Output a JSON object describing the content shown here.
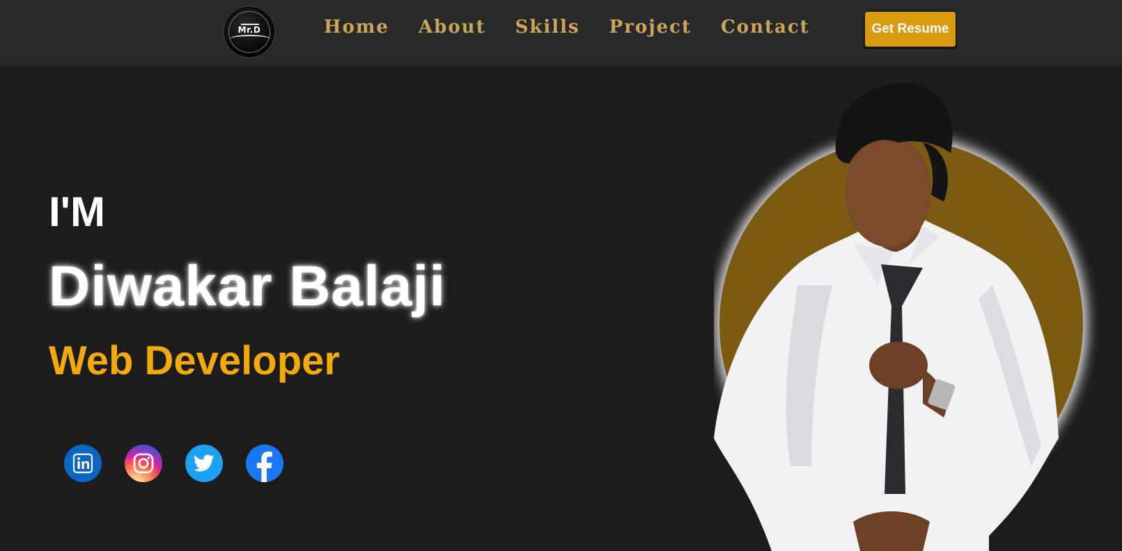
{
  "nav": {
    "logo_text": "Mr.D",
    "links": [
      "Home",
      "About",
      "Skills",
      "Project",
      "Contact"
    ],
    "resume_label": "Get Resume"
  },
  "hero": {
    "intro": "I'M",
    "name": "Diwakar Balaji",
    "role": "Web Developer"
  },
  "socials": [
    {
      "name": "LinkedIn",
      "icon": "linkedin-icon",
      "color": "#0a66c2"
    },
    {
      "name": "Instagram",
      "icon": "instagram-icon",
      "color": "#d6249f"
    },
    {
      "name": "Twitter",
      "icon": "twitter-icon",
      "color": "#1da1f2"
    },
    {
      "name": "Facebook",
      "icon": "facebook-icon",
      "color": "#1877f2"
    }
  ],
  "colors": {
    "background": "#1c1c1c",
    "navbar": "#2a2929",
    "nav_link": "#c9a65a",
    "accent": "#f5a80b",
    "button": "#d99a0e",
    "photo_circle": "#7b5a12"
  }
}
